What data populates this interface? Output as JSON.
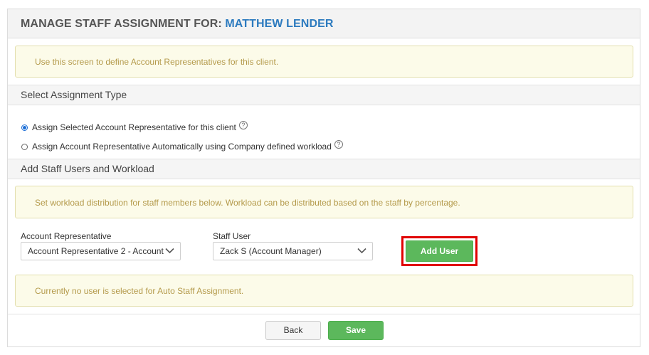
{
  "header": {
    "prefix": "MANAGE STAFF ASSIGNMENT FOR:",
    "client_name": "MATTHEW LENDER"
  },
  "intro_note": "Use this screen to define Account Representatives for this client.",
  "assignment_type": {
    "title": "Select Assignment Type",
    "options": [
      {
        "label": "Assign Selected Account Representative for this client",
        "checked": true
      },
      {
        "label": "Assign Account Representative Automatically using Company defined workload",
        "checked": false
      }
    ]
  },
  "staff_section": {
    "title": "Add Staff Users and Workload",
    "note": "Set workload distribution for staff members below. Workload can be distributed based on the staff by percentage.",
    "account_rep": {
      "label": "Account Representative",
      "value": "Account Representative 2 - Account"
    },
    "staff_user": {
      "label": "Staff User",
      "value": "Zack S (Account Manager)"
    },
    "add_user_label": "Add User",
    "empty_note": "Currently no user is selected for Auto Staff Assignment."
  },
  "footer": {
    "back_label": "Back",
    "save_label": "Save"
  },
  "colors": {
    "accent_blue": "#2d7bbf",
    "button_green": "#5cb85c",
    "highlight_red": "#e00000",
    "note_text": "#b49a4b"
  }
}
